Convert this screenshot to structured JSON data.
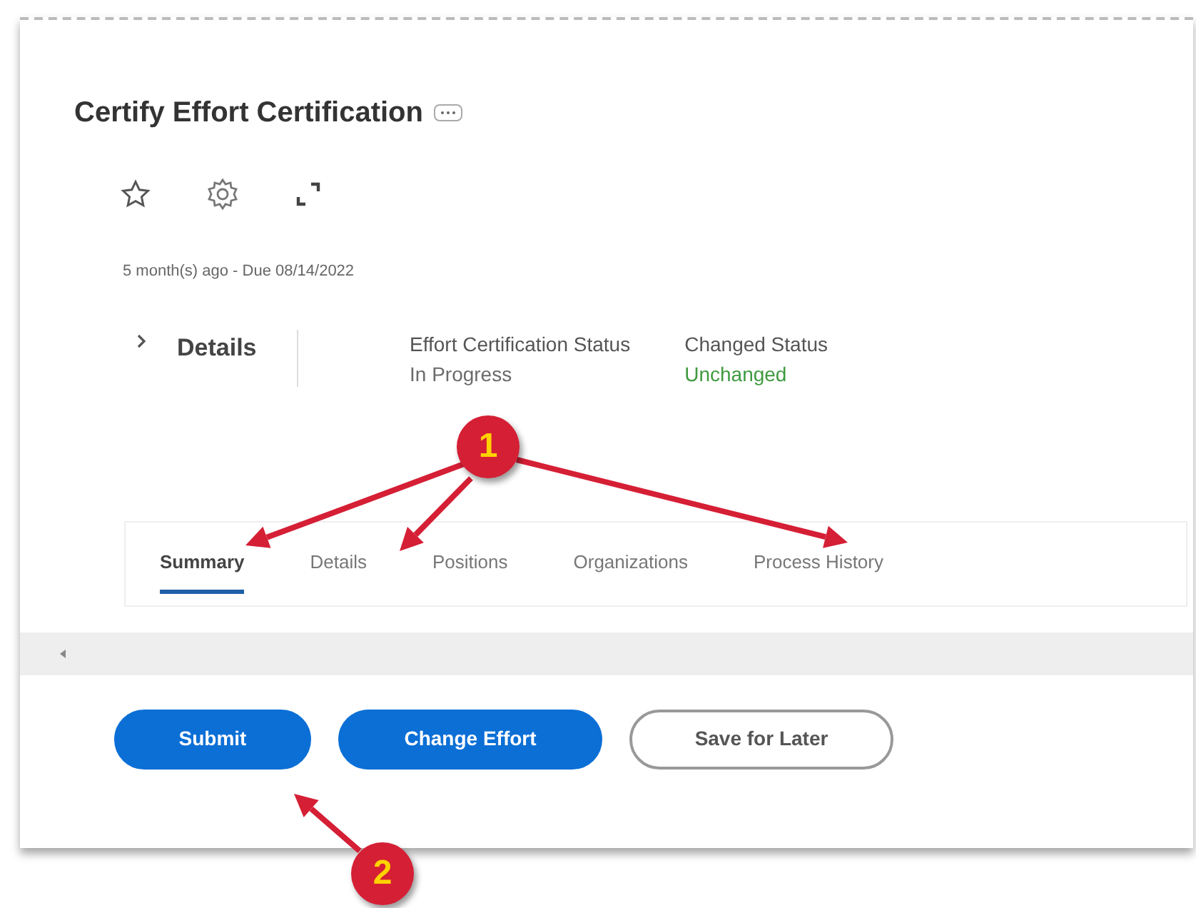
{
  "title": "Certify Effort Certification",
  "subtitle": "5 month(s) ago - Due 08/14/2022",
  "details": {
    "label": "Details",
    "expanded": false,
    "fields": [
      {
        "label": "Effort Certification Status",
        "value": "In Progress",
        "color": "#6b6b6b"
      },
      {
        "label": "Changed Status",
        "value": "Unchanged",
        "color": "#3f9a3f"
      }
    ]
  },
  "tabs": [
    {
      "label": "Summary",
      "selected": true
    },
    {
      "label": "Details",
      "selected": false
    },
    {
      "label": "Positions",
      "selected": false
    },
    {
      "label": "Organizations",
      "selected": false
    },
    {
      "label": "Process History",
      "selected": false
    }
  ],
  "buttons": [
    {
      "label": "Submit",
      "kind": "primary"
    },
    {
      "label": "Change Effort",
      "kind": "primary"
    },
    {
      "label": "Save for Later",
      "kind": "secondary"
    }
  ],
  "callouts": [
    {
      "number": "1"
    },
    {
      "number": "2"
    }
  ]
}
